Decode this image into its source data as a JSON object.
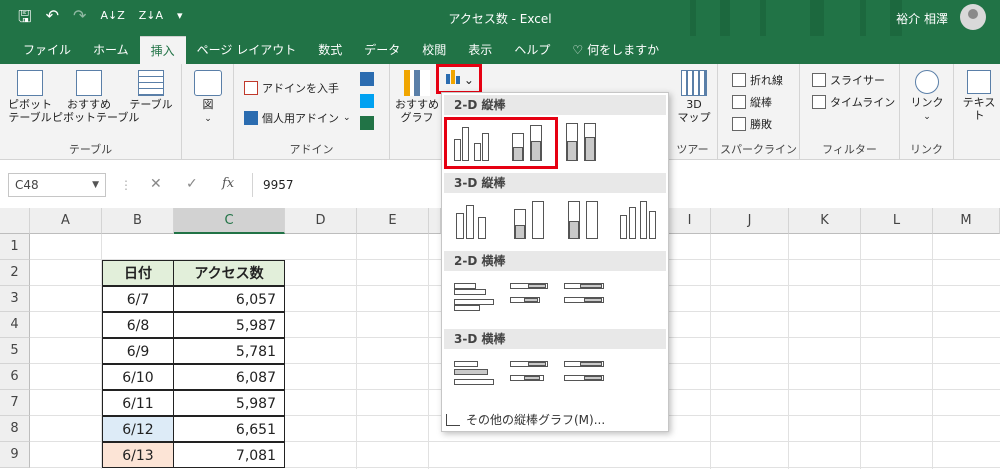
{
  "titlebar": {
    "save_icon": "save-icon",
    "undo_icon": "undo-icon",
    "redo_icon": "redo-icon",
    "sort_asc": "A↓Z",
    "sort_desc": "Z↓A",
    "customize": "▾",
    "title": "アクセス数 - Excel",
    "user_name": "裕介 相澤"
  },
  "tabs": [
    "ファイル",
    "ホーム",
    "挿入",
    "ページ レイアウト",
    "数式",
    "データ",
    "校閲",
    "表示",
    "ヘルプ",
    "何をしますか"
  ],
  "ribbon": {
    "pivot": "ピボット\nテーブル",
    "rec_pivot": "おすすめ\nピボットテーブル",
    "table": "テーブル",
    "group_table": "テーブル",
    "illust": "図",
    "addin_get": "アドインを入手",
    "addin_personal": "個人用アドイン",
    "group_addin": "アドイン",
    "rec_chart": "おすすめ\nグラフ",
    "map3d": "3D\nマップ",
    "group_tour": "ツアー",
    "spark_line": "折れ線",
    "spark_col": "縦棒",
    "spark_wl": "勝敗",
    "group_spark": "スパークライン",
    "slicer": "スライサー",
    "timeline": "タイムライン",
    "group_filter": "フィルター",
    "link": "リンク",
    "group_link": "リンク",
    "text": "テキスト"
  },
  "formula": {
    "name_box": "C48",
    "fx": "fx",
    "cancel": "✕",
    "enter": "✓",
    "value": "9957"
  },
  "columns": [
    "A",
    "B",
    "C",
    "D",
    "E",
    "I",
    "J",
    "K",
    "L",
    "M"
  ],
  "rows": [
    "1",
    "2",
    "3",
    "4",
    "5",
    "6",
    "7",
    "8",
    "9"
  ],
  "table": {
    "header_date": "日付",
    "header_access": "アクセス数",
    "dates": [
      "6/7",
      "6/8",
      "6/9",
      "6/10",
      "6/11",
      "6/12",
      "6/13"
    ],
    "values": [
      "6,057",
      "5,987",
      "5,781",
      "6,087",
      "5,987",
      "6,651",
      "7,081"
    ],
    "highlight_colors": {
      "6/12": "#ddebf7",
      "6/13": "#fce4d6"
    }
  },
  "dropdown": {
    "sec_2d_col": "2-D 縦棒",
    "sec_3d_col": "3-D 縦棒",
    "sec_2d_bar": "2-D 横棒",
    "sec_3d_bar": "3-D 横棒",
    "more": "その他の縦棒グラフ(M)..."
  },
  "colors": {
    "excel_green": "#217346",
    "highlight_red": "#e60012",
    "header_green": "#e2efda"
  }
}
